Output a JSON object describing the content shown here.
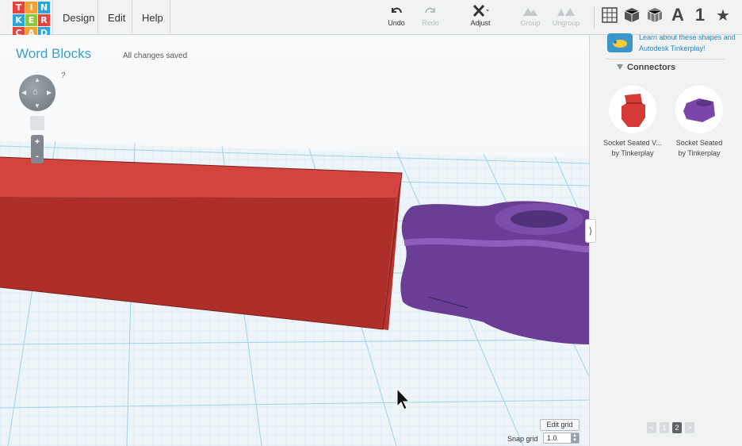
{
  "logo": {
    "letters": [
      "T",
      "I",
      "N",
      "K",
      "E",
      "R",
      "C",
      "A",
      "D"
    ],
    "colors": [
      "#e8423d",
      "#f5a12f",
      "#2aa6df",
      "#2aa6df",
      "#8cc63f",
      "#e8423d",
      "#e8423d",
      "#f5a12f",
      "#2aa6df"
    ]
  },
  "menu": {
    "design": "Design",
    "edit": "Edit",
    "help": "Help"
  },
  "toolbar": {
    "undo": {
      "label": "Undo",
      "icon": "undo-icon"
    },
    "redo": {
      "label": "Redo",
      "icon": "redo-icon"
    },
    "adjust": {
      "label": "Adjust",
      "icon": "adjust-icon"
    },
    "group": {
      "label": "Group",
      "icon": "group-icon"
    },
    "ungroup": {
      "label": "Ungroup",
      "icon": "ungroup-icon"
    },
    "right_icons": [
      "grid-icon",
      "cube-icon",
      "box-icon",
      "text-icon",
      "number-icon",
      "star-icon"
    ],
    "text_glyph": "A",
    "number_glyph": "1"
  },
  "workplane": {
    "design_title": "Word Blocks",
    "save_status": "All changes saved",
    "help_mark": "?",
    "zoom_in": "+",
    "zoom_out": "-",
    "edit_grid_label": "Edit grid",
    "snap_grid_label": "Snap grid",
    "snap_grid_value": "1.0"
  },
  "sidebar": {
    "promo_text": "Learn about these shapes and Autodesk Tinkerplay!",
    "section_title": "Connectors",
    "shapes": [
      {
        "name": "Socket Seated V...",
        "author": "by Tinkerplay",
        "color": "#d63a37"
      },
      {
        "name": "Socket Seated",
        "author": "by Tinkerplay",
        "color": "#7a46a8"
      }
    ],
    "pager": {
      "prev": "<",
      "pages": [
        "1",
        "2"
      ],
      "current": "2",
      "next": ">"
    }
  },
  "colors": {
    "accent": "#39a0d0",
    "box_red": "#cf3d38",
    "socket_purple": "#6a3e97",
    "grid_line": "#9fd3ea"
  }
}
